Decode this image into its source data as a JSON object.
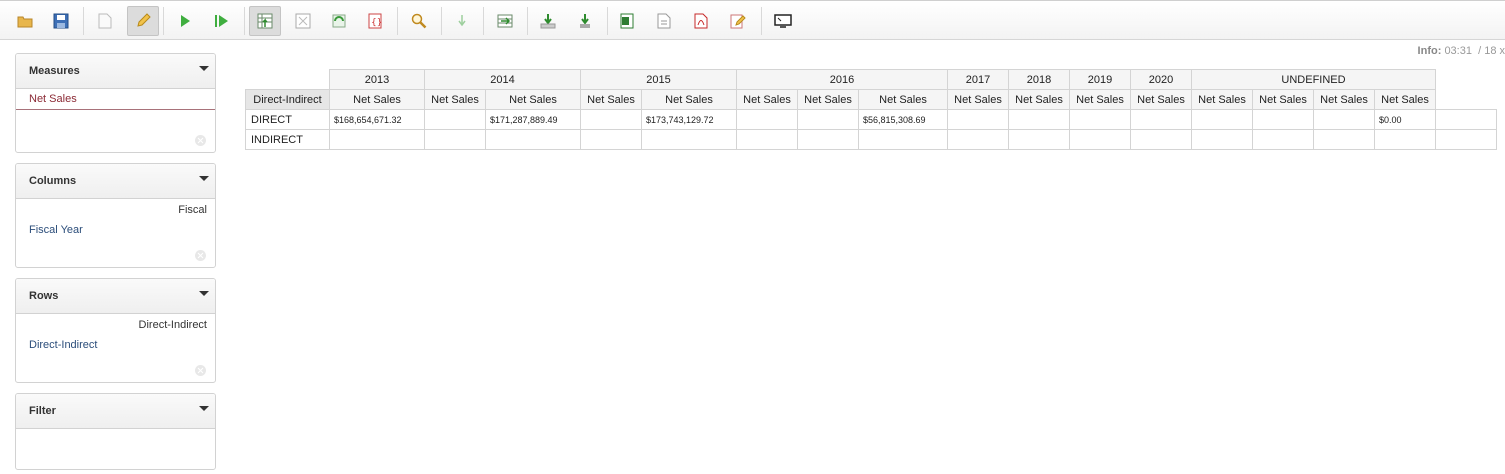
{
  "toolbar": {
    "buttons": [
      {
        "icon": "open-folder-icon",
        "active": false
      },
      {
        "icon": "save-disk-icon",
        "active": false
      },
      {
        "icon": "new-document-icon",
        "active": false
      },
      {
        "icon": "edit-pencil-icon",
        "active": true
      },
      {
        "icon": "run-play-icon",
        "active": false
      },
      {
        "icon": "automatic-execution-icon",
        "active": false
      },
      {
        "icon": "toggle-fields-icon",
        "active": true
      },
      {
        "icon": "non-empty-icon",
        "active": false
      },
      {
        "icon": "swap-axis-icon",
        "active": false
      },
      {
        "icon": "show-mdx-icon",
        "active": false
      },
      {
        "icon": "zoom-magnifier-icon",
        "active": false
      },
      {
        "icon": "drill-down-arrow-icon",
        "active": false
      },
      {
        "icon": "drill-across-icon",
        "active": false
      },
      {
        "icon": "export-download-icon",
        "active": false
      },
      {
        "icon": "drill-through-icon",
        "active": false
      },
      {
        "icon": "export-xls-icon",
        "active": false
      },
      {
        "icon": "export-csv-icon",
        "active": false
      },
      {
        "icon": "export-pdf-icon",
        "active": false
      },
      {
        "icon": "edit-report-icon",
        "active": false
      },
      {
        "icon": "fullscreen-monitor-icon",
        "active": false
      }
    ]
  },
  "info": {
    "label": "Info:",
    "time": "03:31",
    "rest": "/ 18 x"
  },
  "panels": {
    "measures": {
      "title": "Measures",
      "item": "Net Sales"
    },
    "columns": {
      "title": "Columns",
      "header": "Fiscal",
      "item": "Fiscal Year"
    },
    "rows": {
      "title": "Rows",
      "header": "Direct-Indirect",
      "item": "Direct-Indirect"
    },
    "filter": {
      "title": "Filter"
    }
  },
  "pivot": {
    "row_header": "Direct-Indirect",
    "years": [
      {
        "label": "2013",
        "span": 1
      },
      {
        "label": "2014",
        "span": 2
      },
      {
        "label": "2015",
        "span": 2
      },
      {
        "label": "2016",
        "span": 3
      },
      {
        "label": "2017",
        "span": 1
      },
      {
        "label": "2018",
        "span": 1
      },
      {
        "label": "2019",
        "span": 1
      },
      {
        "label": "2020",
        "span": 1
      },
      {
        "label": "UNDEFINED",
        "span": 4
      }
    ],
    "measure_label": "Net Sales",
    "rows": [
      {
        "label": "DIRECT",
        "cells": [
          "$168,654,671.32",
          "",
          "$171,287,889.49",
          "",
          "$173,743,129.72",
          "",
          "",
          "$56,815,308.69",
          "",
          "",
          "",
          "",
          "",
          "",
          "",
          "$0.00",
          ""
        ]
      },
      {
        "label": "INDIRECT",
        "cells": [
          "",
          "",
          "",
          "",
          "",
          "",
          "",
          "",
          "",
          "",
          "",
          "",
          "",
          "",
          "",
          "",
          ""
        ]
      }
    ]
  }
}
